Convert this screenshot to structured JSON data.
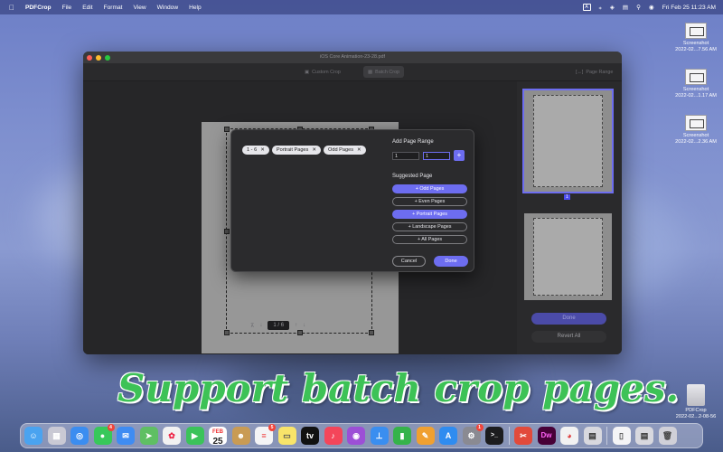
{
  "menubar": {
    "app": "PDFCrop",
    "items": [
      "File",
      "Edit",
      "Format",
      "View",
      "Window",
      "Help"
    ],
    "input_indicator": "A",
    "datetime": "Fri Feb 25  11:23 AM"
  },
  "window": {
    "title": "iOS Core Animation-23-28.pdf",
    "toolbar": {
      "custom_crop": "Custom Crop",
      "batch_crop": "Batch Crop",
      "page_range": "Page Range"
    },
    "pager": {
      "current": "1",
      "separator": "/",
      "total": "6"
    },
    "sidebar": {
      "thumb1_number": "1",
      "done": "Done",
      "revert": "Revert All"
    }
  },
  "dialog": {
    "chips": [
      "1 - 6",
      "Portrait Pages",
      "Odd Pages"
    ],
    "add_range_label": "Add Page Range",
    "range_from": "1",
    "range_to": "1",
    "suggested_label": "Suggested Page",
    "suggestions": [
      {
        "label": "+ Odd Pages",
        "selected": true
      },
      {
        "label": "+ Even Pages",
        "selected": false
      },
      {
        "label": "+ Portrait Pages",
        "selected": true
      },
      {
        "label": "+ Landscape Pages",
        "selected": false
      },
      {
        "label": "+ All Pages",
        "selected": false
      }
    ],
    "cancel": "Cancel",
    "done": "Done"
  },
  "desktop": {
    "icons": [
      {
        "name": "Screenshot",
        "date": "2022-02...7.56 AM"
      },
      {
        "name": "Screenshot",
        "date": "2022-02...1.17 AM"
      },
      {
        "name": "Screenshot",
        "date": "2022-02...2.36 AM"
      },
      {
        "name": "PDFCrop",
        "date": "2022-02...2-08-56"
      }
    ]
  },
  "headline": "Support batch crop pages.",
  "dock": {
    "calendar": {
      "month": "FEB",
      "day": "25"
    },
    "badges": {
      "messages": "4",
      "reminders": "5",
      "system_prefs": "1"
    },
    "dw_label": "Dw"
  },
  "colors": {
    "accent": "#6d6df0",
    "headline": "#3dc256"
  }
}
